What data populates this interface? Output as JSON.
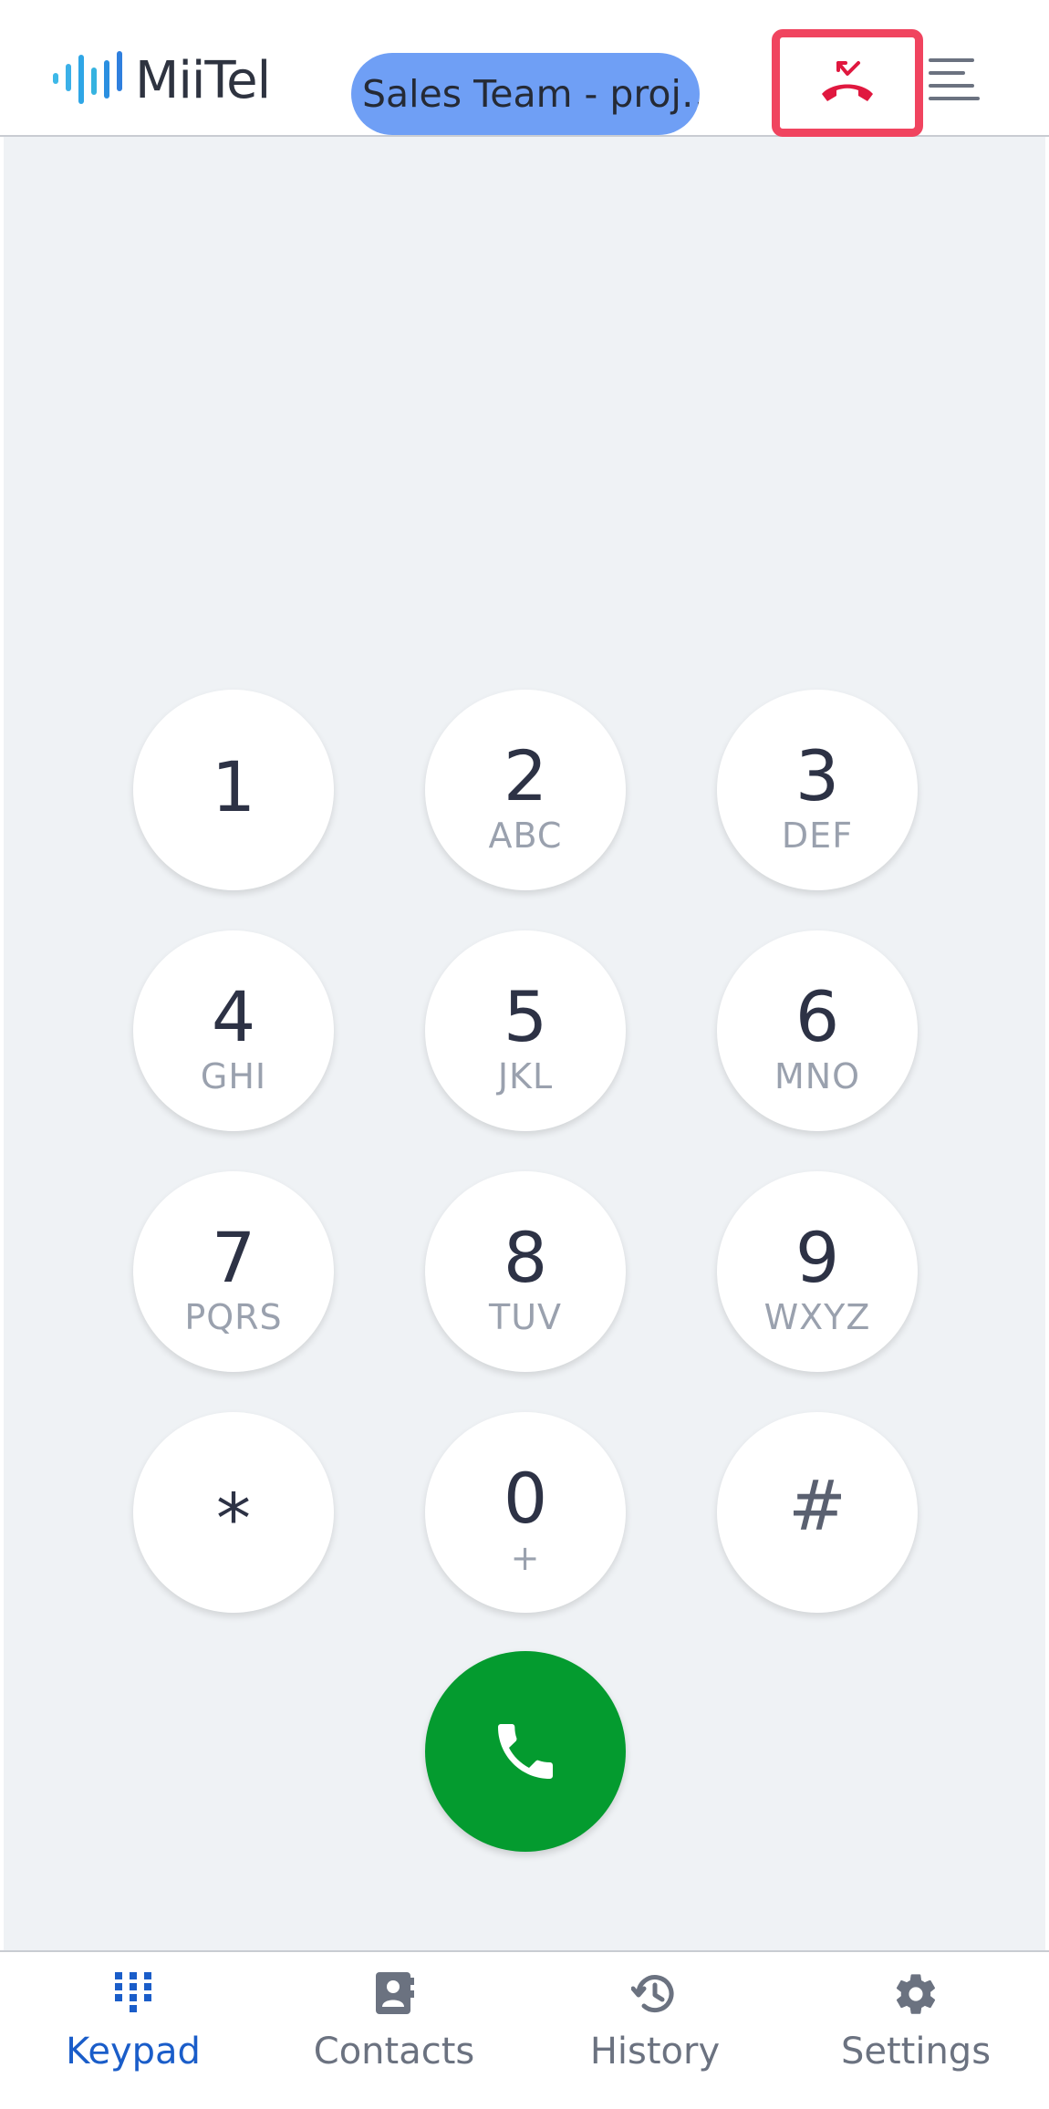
{
  "app": {
    "logo_text": "MiiTel",
    "team_label": "Sales Team - proj…"
  },
  "keypad": {
    "keys": [
      {
        "digit": "1",
        "letters": ""
      },
      {
        "digit": "2",
        "letters": "ABC"
      },
      {
        "digit": "3",
        "letters": "DEF"
      },
      {
        "digit": "4",
        "letters": "GHI"
      },
      {
        "digit": "5",
        "letters": "JKL"
      },
      {
        "digit": "6",
        "letters": "MNO"
      },
      {
        "digit": "7",
        "letters": "PQRS"
      },
      {
        "digit": "8",
        "letters": "TUV"
      },
      {
        "digit": "9",
        "letters": "WXYZ"
      },
      {
        "digit": "*",
        "letters": ""
      },
      {
        "digit": "0",
        "letters": "+"
      },
      {
        "digit": "#",
        "letters": ""
      }
    ]
  },
  "nav": {
    "items": [
      {
        "label": "Keypad",
        "icon": "keypad-icon",
        "active": true
      },
      {
        "label": "Contacts",
        "icon": "contacts-icon",
        "active": false
      },
      {
        "label": "History",
        "icon": "history-icon",
        "active": false
      },
      {
        "label": "Settings",
        "icon": "gear-icon",
        "active": false
      }
    ]
  },
  "colors": {
    "accent": "#1a5dc9",
    "call_green": "#049b2f",
    "missed_red": "#e0183f",
    "highlight_border": "#f0445f",
    "team_pill": "#6f9ff5"
  }
}
